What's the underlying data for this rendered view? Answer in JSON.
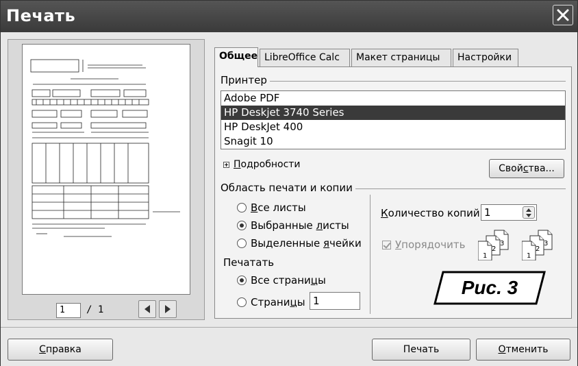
{
  "window": {
    "title": "Печать"
  },
  "preview": {
    "page_current": "1",
    "page_total": "/ 1"
  },
  "tabs": [
    {
      "label": "Общее",
      "active": true
    },
    {
      "label": "LibreOffice Calc",
      "active": false
    },
    {
      "label": "Макет страницы",
      "active": false
    },
    {
      "label": "Настройки",
      "active": false
    }
  ],
  "printer": {
    "group_label": "Принтер",
    "items": [
      "Adobe PDF",
      "HP Deskjet 3740 Series",
      "HP DeskJet 400",
      "Snagit 10"
    ],
    "selected": "HP Deskjet 3740 Series",
    "details_pre": "",
    "details_accel": "П",
    "details_post": "одробности",
    "properties_pre": "Свой",
    "properties_accel": "с",
    "properties_post": "тва..."
  },
  "print_area": {
    "group_label": "Область печати и копии",
    "options": [
      {
        "pre": "",
        "accel": "В",
        "post": "се листы",
        "checked": false
      },
      {
        "pre": "Выбранные ",
        "accel": "л",
        "post": "исты",
        "checked": true
      },
      {
        "pre": "Выделенные ",
        "accel": "я",
        "post": "чейки",
        "checked": false
      }
    ],
    "print_label": "Печатать",
    "pages_options": [
      {
        "pre": "Все страни",
        "accel": "ц",
        "post": "ы",
        "checked": true
      },
      {
        "pre": "Страни",
        "accel": "ц",
        "post": "ы",
        "checked": false
      }
    ],
    "pages_value": "1"
  },
  "copies": {
    "label_pre": "",
    "label_accel": "К",
    "label_post": "оличество копий",
    "value": "1",
    "collate_pre": "",
    "collate_accel": "У",
    "collate_post": "порядочить",
    "collate_checked": true,
    "collate_enabled": false
  },
  "figure_label": "Рис. 3",
  "buttons": {
    "help_accel": "С",
    "help_post": "правка",
    "print": "Печать",
    "cancel_accel": "О",
    "cancel_post": "тменить"
  },
  "colors": {
    "titlebar": "#444444",
    "selection": "#3a3a3a"
  }
}
